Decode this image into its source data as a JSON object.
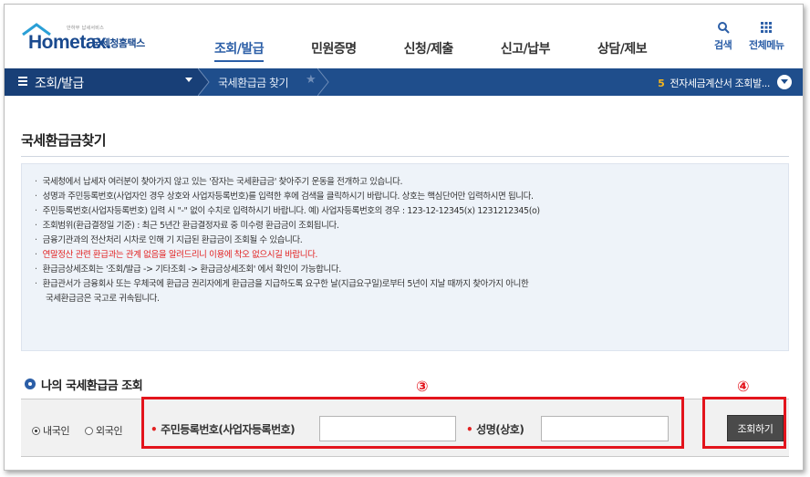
{
  "header": {
    "logo_small": "안하무 납세서비스",
    "logo_text": "Hometax.",
    "logo_korean": "국세청홈택스",
    "nav": [
      {
        "label": "조회/발급",
        "active": true
      },
      {
        "label": "민원증명",
        "active": false
      },
      {
        "label": "신청/제출",
        "active": false
      },
      {
        "label": "신고/납부",
        "active": false
      },
      {
        "label": "상담/제보",
        "active": false
      }
    ],
    "search_label": "검색",
    "menu_label": "전체메뉴"
  },
  "menubar": {
    "title": "조회/발급",
    "breadcrumb": "국세환급금 찾기",
    "right_num": "5",
    "right_text": "전자세금계산서 조회발..."
  },
  "page_title": "국세환급금찾기",
  "notice": [
    {
      "text": "국세청에서 납세자 여러분이 찾아가지 않고 있는 '잠자는 국세환급금' 찾아주기 운동을 전개하고 있습니다.",
      "style": "normal"
    },
    {
      "text": "성명과 주민등록번호(사업자인 경우 상호와 사업자등록번호)를 입력한 후에 검색을 클릭하시기 바랍니다. 상호는 핵심단어만 입력하시면 됩니다.",
      "style": "normal"
    },
    {
      "text": "주민등록번호(사업자등록번호) 입력 시 \"-\" 없이 수치로 입력하시기 바랍니다. 예) 사업자등록번호의 경우 : 123-12-12345(x) 1231212345(o)",
      "style": "normal"
    },
    {
      "text": "조회범위(환급결정일 기준) : 최근 5년간 환급결정자료 중 미수령 환급금이 조회됩니다.",
      "style": "normal"
    },
    {
      "text": "금융기관과의 전산처리 시차로 인해 기 지급된 환급금이 조회될 수 있습니다.",
      "style": "normal"
    },
    {
      "text": "연말정산 관련 환급과는 관계 없음을 알려드리니 이용에 착오 없으시길 바랍니다.",
      "style": "red"
    },
    {
      "text": "환급금상세조회는 '조회/발급 -> 기타조회 -> 환급금상세조회' 에서 확인이 가능합니다.",
      "style": "normal"
    },
    {
      "text": "환급관서가 금융회사 또는 우체국에 환급금 권리자에게 환급금을 지급하도록 요구한 날(지급요구일)로부터 5년이 지날 때까지 찾아가지 아니한",
      "style": "normal"
    },
    {
      "text": "국세환급금은 국고로 귀속됩니다.",
      "style": "cont"
    }
  ],
  "section_title": "나의 국세환급금 조회",
  "form": {
    "radio_domestic": "내국인",
    "radio_foreign": "외국인",
    "selected": "domestic",
    "id_label": "주민등록번호(사업자등록번호)",
    "id_value": "",
    "name_label": "성명(상호)",
    "name_value": "",
    "search_button": "조회하기"
  },
  "annotations": {
    "box3_label": "③",
    "box4_label": "④",
    "color": "#e3141c"
  },
  "colors": {
    "brand_blue": "#1f4e8c",
    "notice_red": "#e22222"
  }
}
